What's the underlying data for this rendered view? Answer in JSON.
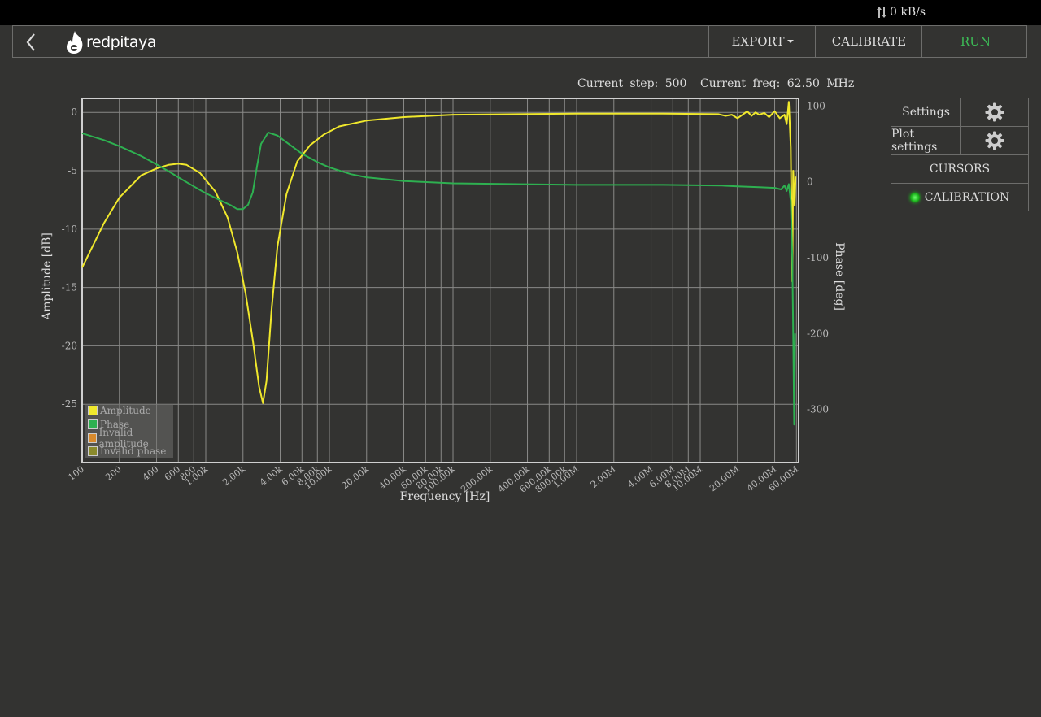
{
  "topbar": {
    "rate": "0 kB/s"
  },
  "nav": {
    "brand": "redpitaya",
    "export_label": "EXPORT",
    "calibrate_label": "CALIBRATE",
    "run_label": "RUN",
    "run_color": "#3cbc56"
  },
  "status": {
    "step": "Current  step:  500",
    "freq": "Current  freq:  62.50  MHz"
  },
  "panel": {
    "settings_label": "Settings",
    "plot_settings_label": "Plot settings",
    "cursors_label": "CURSORS",
    "calibration_label": "CALIBRATION"
  },
  "legend": {
    "items": [
      {
        "label": "Amplitude",
        "color": "#f0e82c"
      },
      {
        "label": "Phase",
        "color": "#2eb050"
      },
      {
        "label": "Invalid amplitude",
        "color": "#d88a2c"
      },
      {
        "label": "Invalid phase",
        "color": "#8a8a2c"
      }
    ]
  },
  "chart_data": {
    "type": "line",
    "xscale": "log",
    "xlabel": "Frequency  [Hz]",
    "ylabel": "Amplitude  [dB]",
    "y2label": "Phase  [deg]",
    "xlim": [
      100,
      62500000
    ],
    "ylim": [
      -30,
      1.2
    ],
    "y2lim": [
      -370,
      110
    ],
    "grid": true,
    "legend": "bottom-left",
    "x_ticks": [
      {
        "v": 100,
        "l": "100"
      },
      {
        "v": 200,
        "l": "200"
      },
      {
        "v": 400,
        "l": "400"
      },
      {
        "v": 600,
        "l": "600"
      },
      {
        "v": 800,
        "l": "800"
      },
      {
        "v": 1000,
        "l": "1.00k"
      },
      {
        "v": 2000,
        "l": "2.00k"
      },
      {
        "v": 4000,
        "l": "4.00k"
      },
      {
        "v": 6000,
        "l": "6.00k"
      },
      {
        "v": 8000,
        "l": "8.00k"
      },
      {
        "v": 10000,
        "l": "10.00k"
      },
      {
        "v": 20000,
        "l": "20.00k"
      },
      {
        "v": 40000,
        "l": "40.00k"
      },
      {
        "v": 60000,
        "l": "60.00k"
      },
      {
        "v": 80000,
        "l": "80.00k"
      },
      {
        "v": 100000,
        "l": "100.00k"
      },
      {
        "v": 200000,
        "l": "200.00k"
      },
      {
        "v": 400000,
        "l": "400.00k"
      },
      {
        "v": 600000,
        "l": "600.00k"
      },
      {
        "v": 800000,
        "l": "800.00k"
      },
      {
        "v": 1000000,
        "l": "1.00M"
      },
      {
        "v": 2000000,
        "l": "2.00M"
      },
      {
        "v": 4000000,
        "l": "4.00M"
      },
      {
        "v": 6000000,
        "l": "6.00M"
      },
      {
        "v": 8000000,
        "l": "8.00M"
      },
      {
        "v": 10000000,
        "l": "10.00M"
      },
      {
        "v": 20000000,
        "l": "20.00M"
      },
      {
        "v": 40000000,
        "l": "40.00M"
      },
      {
        "v": 60000000,
        "l": "60.00M"
      }
    ],
    "y_ticks": [
      0,
      -5,
      -10,
      -15,
      -20,
      -25
    ],
    "y2_ticks": [
      100,
      0,
      -100,
      -200,
      -300
    ],
    "series": [
      {
        "name": "Amplitude",
        "axis": "left",
        "color": "#f0e82c",
        "points": [
          [
            100,
            -13.3
          ],
          [
            150,
            -9.5
          ],
          [
            200,
            -7.3
          ],
          [
            300,
            -5.4
          ],
          [
            400,
            -4.8
          ],
          [
            500,
            -4.5
          ],
          [
            600,
            -4.4
          ],
          [
            700,
            -4.5
          ],
          [
            900,
            -5.2
          ],
          [
            1200,
            -6.8
          ],
          [
            1500,
            -9.0
          ],
          [
            1800,
            -12.0
          ],
          [
            2100,
            -15.5
          ],
          [
            2400,
            -19.5
          ],
          [
            2700,
            -23.5
          ],
          [
            2900,
            -24.9
          ],
          [
            3100,
            -23.0
          ],
          [
            3400,
            -17.0
          ],
          [
            3800,
            -11.5
          ],
          [
            4500,
            -7.0
          ],
          [
            5500,
            -4.2
          ],
          [
            7000,
            -2.8
          ],
          [
            9000,
            -1.9
          ],
          [
            12000,
            -1.2
          ],
          [
            20000,
            -0.7
          ],
          [
            40000,
            -0.4
          ],
          [
            100000,
            -0.2
          ],
          [
            1000000,
            -0.1
          ],
          [
            5000000,
            -0.1
          ],
          [
            14000000,
            -0.15
          ],
          [
            16000000,
            -0.3
          ],
          [
            18000000,
            -0.2
          ],
          [
            20000000,
            -0.5
          ],
          [
            22000000,
            -0.2
          ],
          [
            24000000,
            0.1
          ],
          [
            26000000,
            -0.3
          ],
          [
            28000000,
            0.0
          ],
          [
            30000000,
            -0.2
          ],
          [
            33000000,
            -0.05
          ],
          [
            36000000,
            -0.4
          ],
          [
            40000000,
            0.1
          ],
          [
            44000000,
            -0.5
          ],
          [
            48000000,
            -0.2
          ],
          [
            50000000,
            -1.0
          ],
          [
            52000000,
            0.9
          ],
          [
            54000000,
            -3.0
          ],
          [
            55500000,
            -14.5
          ],
          [
            56500000,
            -5.0
          ],
          [
            58000000,
            -8.0
          ],
          [
            59000000,
            -5.5
          ]
        ]
      },
      {
        "name": "Phase",
        "axis": "right",
        "color": "#2eb050",
        "points": [
          [
            100,
            64
          ],
          [
            150,
            55
          ],
          [
            200,
            47
          ],
          [
            300,
            34
          ],
          [
            400,
            23
          ],
          [
            500,
            14
          ],
          [
            600,
            6
          ],
          [
            800,
            -6
          ],
          [
            1000,
            -15
          ],
          [
            1300,
            -24
          ],
          [
            1600,
            -31
          ],
          [
            1800,
            -36
          ],
          [
            2000,
            -36
          ],
          [
            2200,
            -30
          ],
          [
            2400,
            -14
          ],
          [
            2600,
            21
          ],
          [
            2800,
            50
          ],
          [
            3200,
            65
          ],
          [
            3800,
            61
          ],
          [
            4500,
            52
          ],
          [
            6000,
            37
          ],
          [
            8000,
            26
          ],
          [
            10000,
            19
          ],
          [
            15000,
            10
          ],
          [
            20000,
            6
          ],
          [
            40000,
            1
          ],
          [
            100000,
            -2
          ],
          [
            1000000,
            -4
          ],
          [
            5000000,
            -4
          ],
          [
            15000000,
            -5
          ],
          [
            20000000,
            -6
          ],
          [
            30000000,
            -7
          ],
          [
            40000000,
            -8
          ],
          [
            45000000,
            -10
          ],
          [
            48000000,
            -5
          ],
          [
            50000000,
            -12
          ],
          [
            52000000,
            -3
          ],
          [
            54000000,
            -25
          ],
          [
            55500000,
            -100
          ],
          [
            56500000,
            -200
          ],
          [
            57500000,
            -320
          ],
          [
            58500000,
            -200
          ]
        ]
      }
    ]
  }
}
